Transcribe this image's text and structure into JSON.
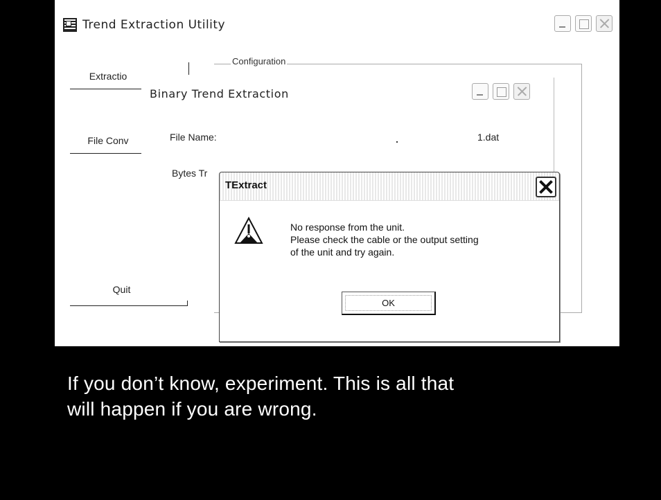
{
  "main_window": {
    "title": "Trend Extraction Utility",
    "icon": "app-icon"
  },
  "sidebar": {
    "extraction_label": "Extractio",
    "file_conv_label": "File Conv",
    "quit_label": "Quit"
  },
  "config_group": {
    "legend": "Configuration"
  },
  "child_window": {
    "title": "Binary Trend Extraction",
    "file_name_label": "File Name:",
    "file_name_value": "1.dat",
    "bytes_label": "Bytes Tr"
  },
  "dialog": {
    "title": "TExtract",
    "icon": "warning-icon",
    "message": [
      "No response from the unit.",
      "Please check the cable or the output setting",
      "of the unit and try again."
    ],
    "ok_label": "OK"
  },
  "caption": {
    "line1": "If you don’t know, experiment.  This is all that",
    "line2": "will happen if you are wrong."
  }
}
